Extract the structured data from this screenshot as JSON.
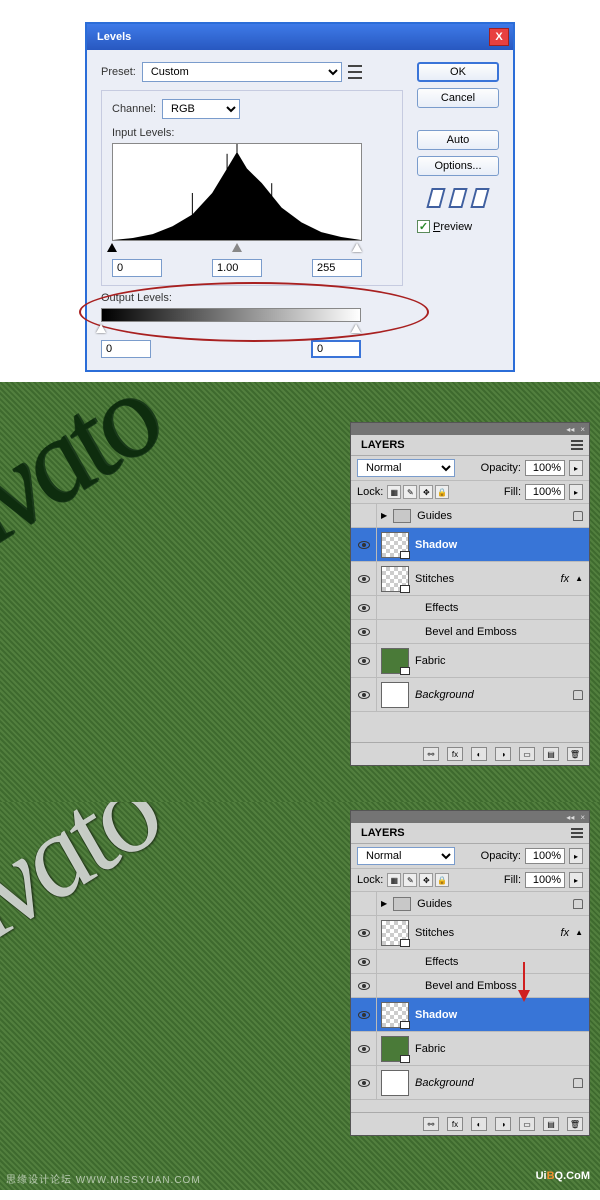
{
  "levels": {
    "title": "Levels",
    "close_x": "X",
    "preset_label": "Preset:",
    "preset_value": "Custom",
    "channel_label": "Channel:",
    "channel_value": "RGB",
    "input_levels_label": "Input Levels:",
    "input_black": "0",
    "input_gamma": "1.00",
    "input_white": "255",
    "output_levels_label": "Output Levels:",
    "output_black": "0",
    "output_white": "0",
    "buttons": {
      "ok": "OK",
      "cancel": "Cancel",
      "auto": "Auto",
      "options": "Options..."
    },
    "preview_check": "✓",
    "preview_label": "Preview"
  },
  "layers1": {
    "panel_title": "LAYERS",
    "blend_mode": "Normal",
    "opacity_label": "Opacity:",
    "opacity_value": "100%",
    "lock_label": "Lock:",
    "fill_label": "Fill:",
    "fill_value": "100%",
    "rows": {
      "guides": "Guides",
      "shadow": "Shadow",
      "stitches": "Stitches",
      "effects": "Effects",
      "bevel": "Bevel and Emboss",
      "fabric": "Fabric",
      "background": "Background",
      "fx": "fx"
    }
  },
  "layers2": {
    "panel_title": "LAYERS",
    "blend_mode": "Normal",
    "opacity_label": "Opacity:",
    "opacity_value": "100%",
    "lock_label": "Lock:",
    "fill_label": "Fill:",
    "fill_value": "100%",
    "rows": {
      "guides": "Guides",
      "stitches": "Stitches",
      "effects": "Effects",
      "bevel": "Bevel and Emboss",
      "shadow": "Shadow",
      "fabric": "Fabric",
      "background": "Background",
      "fx": "fx"
    }
  },
  "watermark_left": "思缘设计论坛 WWW.MISSYUAN.COM",
  "watermark_right_a": "Ui",
  "watermark_right_b": "B",
  "watermark_right_c": "Q.CoM"
}
